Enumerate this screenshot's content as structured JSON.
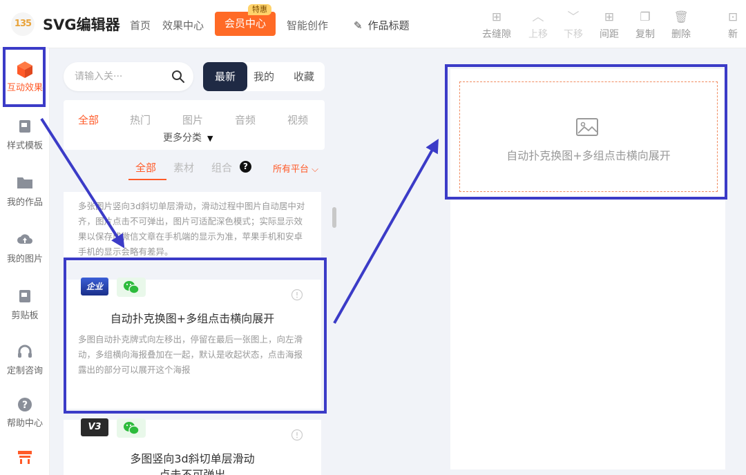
{
  "header": {
    "logo_text": "135",
    "app_title": "SVG编辑器",
    "nav": [
      "首页",
      "效果中心"
    ],
    "vip_label": "会员中心",
    "vip_badge": "特惠",
    "smart_create": "智能创作",
    "work_title": "作品标题",
    "tools": [
      {
        "label": "去缝隙",
        "icon": "grid-plus-icon",
        "enabled": true
      },
      {
        "label": "上移",
        "icon": "chevron-up-icon",
        "enabled": false
      },
      {
        "label": "下移",
        "icon": "chevron-down-icon",
        "enabled": false
      },
      {
        "label": "间距",
        "icon": "spacing-icon",
        "enabled": true
      },
      {
        "label": "复制",
        "icon": "copy-icon",
        "enabled": true
      },
      {
        "label": "删除",
        "icon": "trash-icon",
        "enabled": true
      },
      {
        "label": "新",
        "icon": "new-icon",
        "enabled": true
      }
    ]
  },
  "sidebar": {
    "items": [
      {
        "label": "互动效果",
        "icon": "cube-icon",
        "active": true
      },
      {
        "label": "样式模板",
        "icon": "template-icon"
      },
      {
        "label": "我的作品",
        "icon": "folder-icon"
      },
      {
        "label": "我的图片",
        "icon": "cloud-upload-icon"
      },
      {
        "label": "剪贴板",
        "icon": "clipboard-icon"
      },
      {
        "label": "定制咨询",
        "icon": "headset-icon"
      },
      {
        "label": "帮助中心",
        "icon": "help-icon"
      }
    ]
  },
  "panel": {
    "search_placeholder": "请输入关···",
    "segments": [
      "最新",
      "我的",
      "收藏"
    ],
    "categories": [
      "全部",
      "热门",
      "图片",
      "音频",
      "视频"
    ],
    "more_categories": "更多分类",
    "filter_tabs": [
      "全部",
      "素材",
      "组合"
    ],
    "platform": "所有平台",
    "cards": [
      {
        "desc": "多张图片竖向3d斜切单层滑动，滑动过程中图片自动居中对齐，图片点击不可弹出，图片可适配深色模式；实际显示效果以保存成微信文章在手机端的显示为准，苹果手机和安卓手机的显示会略有差异。"
      },
      {
        "badge": "企业",
        "title": "自动扑克换图+多组点击横向展开",
        "desc": "多图自动扑克牌式向左移出，停留在最后一张图上，向左滑动，多组横向海报叠加在一起，默认是收起状态，点击海报露出的部分可以展开这个海报"
      },
      {
        "badge": "V3",
        "title": "多图竖向3d斜切单层滑动",
        "subtitle": "点击不可弹出"
      }
    ]
  },
  "canvas": {
    "placeholder_text": "自动扑克换图+多组点击横向展开"
  },
  "colors": {
    "accent": "#ff5a28",
    "vip": "#ff6a26",
    "annotation": "#3b3bc7",
    "dark_segment": "#1f2a44"
  }
}
